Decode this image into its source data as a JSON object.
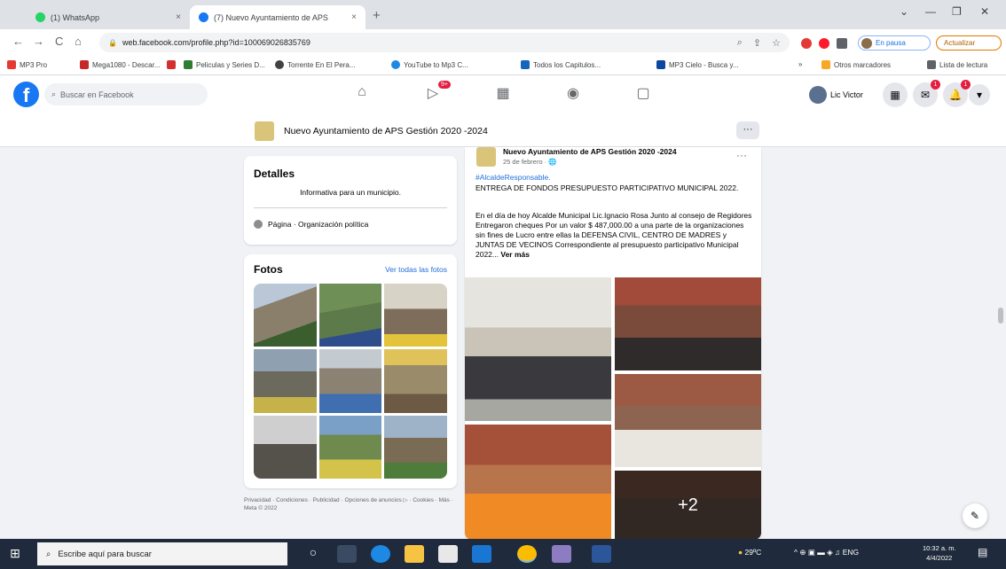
{
  "browser": {
    "tabs": [
      {
        "title": "(1) WhatsApp",
        "close": "×"
      },
      {
        "title": "(7) Nuevo Ayuntamiento de APS",
        "close": "×"
      }
    ],
    "new_tab": "+",
    "window_controls": [
      "⌄",
      "—",
      "❐",
      "✕"
    ],
    "nav": {
      "back": "←",
      "forward": "→",
      "reload": "C",
      "home": "⌂"
    },
    "url": "web.facebook.com/profile.php?id=100069026835769",
    "profile_label": "En pausa",
    "update_label": "Actualizar",
    "bookmarks": [
      {
        "label": "MP3 Pro",
        "color": "#e53935"
      },
      {
        "label": "Mega1080 - Descar...",
        "color": "#c62828"
      },
      {
        "label": "",
        "color": "#d32f2f"
      },
      {
        "label": "Peliculas y Series D...",
        "color": "#2e7d32"
      },
      {
        "label": "Torrente En El Pera...",
        "color": "#424242"
      },
      {
        "label": "YouTube to Mp3 C...",
        "color": "#1e88e5"
      },
      {
        "label": "Todos los Capitulos...",
        "color": "#1565c0"
      },
      {
        "label": "MP3 Cielo - Busca y...",
        "color": "#0d47a1"
      },
      {
        "label": "Otros marcadores",
        "color": "#f9a825"
      },
      {
        "label": "Lista de lectura",
        "color": "#5f6368"
      }
    ],
    "bookmarks_more": "»"
  },
  "facebook": {
    "logo": "f",
    "search_placeholder": "Buscar en Facebook",
    "video_badge": "9+",
    "user_name": "Lic Victor",
    "messenger_badge": "1",
    "notif_badge": "1"
  },
  "page_bar": {
    "name": "Nuevo Ayuntamiento de APS Gestión 2020 -2024",
    "more": "···"
  },
  "details": {
    "title": "Detalles",
    "description": "Informativa para un municipio.",
    "category": "Página · Organización política"
  },
  "photos": {
    "title": "Fotos",
    "see_all": "Ver todas las fotos",
    "thumb_colors": [
      "#8a7f6a",
      "#5d7a4a",
      "#7e6d5a",
      "#6b6a5c",
      "#8c8273",
      "#9a8c6a",
      "#55524c",
      "#6f8a4f",
      "#7a6b55"
    ]
  },
  "footer": "Privacidad · Condiciones · Publicidad · Opciones de anuncios ▷ · Cookies · Más · Meta © 2022",
  "post": {
    "author": "Nuevo Ayuntamiento de APS Gestión 2020 -2024",
    "date": "25 de febrero · 🌐",
    "more": "···",
    "hashtag": "#AlcaldeResponsable.",
    "headline": "ENTREGA DE FONDOS PRESUPUESTO PARTICIPATIVO MUNICIPAL 2022.",
    "body": "En el día de hoy Alcalde Municipal Lic.Ignacio Rosa Junto al consejo de Regidores Entregaron cheques Por un valor $ 487,000.00 a una parte de la organizaciones sin fines de Lucro entre ellas la DEFENSA CIVIL, CENTRO DE MADRES y JUNTAS DE VECINOS Correspondiente al presupuesto participativo Municipal 2022...",
    "see_more": "Ver más",
    "more_photos": "+2",
    "photo_colors": [
      "#c9c3b8",
      "#7a4a3a",
      "#8c6450",
      "#b8744a",
      "#5a4a42"
    ]
  },
  "edit_icon_label": "✎",
  "taskbar": {
    "search_placeholder": "Escribe aquí para buscar",
    "weather": "29ºC",
    "tray": "^ ⊕ ▣ ▬ ◈ ♫ ENG",
    "time": "10:32 a. m.",
    "date": "4/4/2022",
    "apps": [
      {
        "name": "task-view",
        "color": "#3b4a63"
      },
      {
        "name": "edge",
        "color": "#1e88e5"
      },
      {
        "name": "explorer",
        "color": "#f6c342"
      },
      {
        "name": "store",
        "color": "#3b4a63"
      },
      {
        "name": "mail",
        "color": "#1976d2"
      },
      {
        "name": "chrome",
        "color": "#fbbc04"
      },
      {
        "name": "winrar",
        "color": "#8e7cc3"
      },
      {
        "name": "word",
        "color": "#2b579a"
      }
    ]
  }
}
